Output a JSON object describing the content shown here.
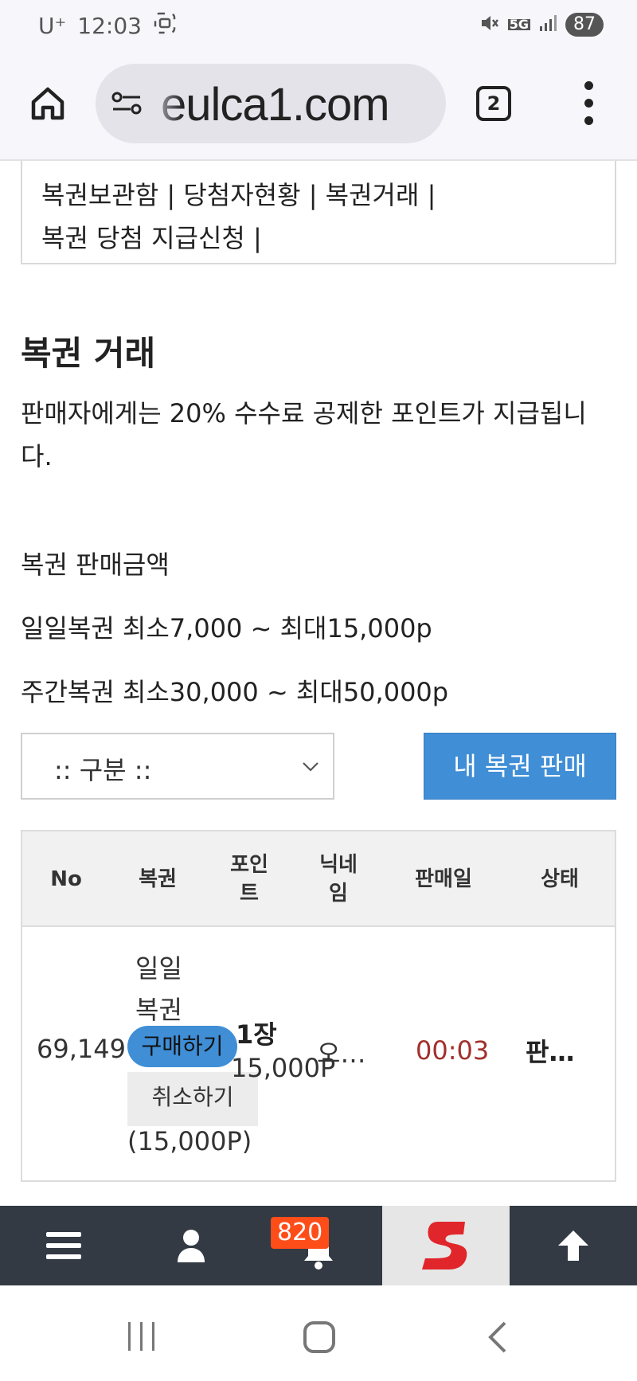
{
  "status_bar": {
    "carrier": "U⁺",
    "time": "12:03",
    "network": "5G",
    "battery": "87"
  },
  "browser": {
    "url_text": "eulca1.com",
    "tab_count": "2"
  },
  "nav_links": {
    "items": [
      "복권보관함",
      "당첨자현황",
      "복권거래",
      "복권 당첨 지급신청"
    ],
    "separator": "|"
  },
  "section": {
    "title": "복권 거래",
    "description": "판매자에게는 20% 수수료 공제한 포인트가 지급됩니다.",
    "price_label": "복권 판매금액",
    "daily_price": "일일복권 최소7,000 ~ 최대15,000p",
    "weekly_price": "주간복권 최소30,000 ~ 최대50,000p"
  },
  "filter": {
    "select_value": ":: 구분 ::",
    "sell_button": "내 복권 판매"
  },
  "table": {
    "headers": {
      "no": "No",
      "type": "복권",
      "points": "포인\n트",
      "nickname": "닉네\n임",
      "date": "판매일",
      "status": "상태"
    },
    "rows": [
      {
        "no": "69,149",
        "type": "일일\n복권",
        "buy": "구매하기",
        "cancel": "취소하기",
        "paren_points": "(15,000P)",
        "count": "1장",
        "points": "15,000P",
        "nickname": "오…",
        "date": "00:03",
        "status": "판…"
      }
    ]
  },
  "toolbar": {
    "badge_count": "820"
  },
  "colors": {
    "accent": "#3f8ed6",
    "toolbar_bg": "#333a44",
    "badge": "#ff4d1a",
    "date_red": "#a0312b",
    "logo_red": "#e0262b"
  }
}
